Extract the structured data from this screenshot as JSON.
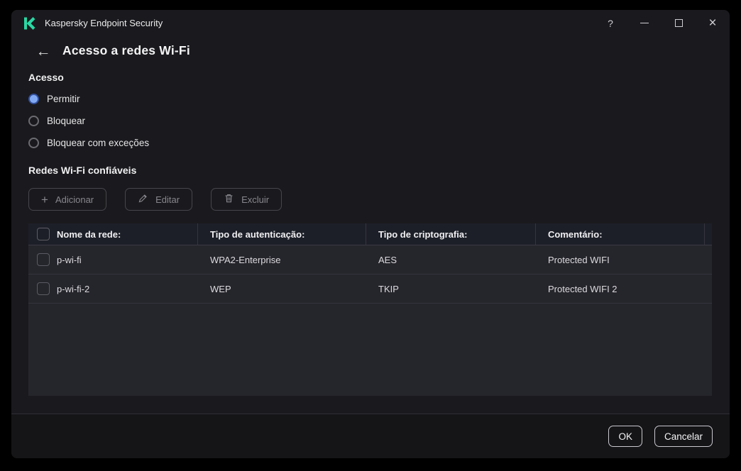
{
  "window": {
    "title": "Kaspersky Endpoint Security",
    "help_glyph": "?"
  },
  "page": {
    "back_glyph": "←",
    "title": "Acesso a redes Wi-Fi"
  },
  "access": {
    "heading": "Acesso",
    "options": [
      {
        "label": "Permitir",
        "selected": true
      },
      {
        "label": "Bloquear",
        "selected": false
      },
      {
        "label": "Bloquear com exceções",
        "selected": false
      }
    ]
  },
  "trusted": {
    "heading": "Redes Wi-Fi confiáveis",
    "toolbar": {
      "add_label": "Adicionar",
      "add_glyph": "+",
      "edit_label": "Editar",
      "delete_label": "Excluir"
    },
    "table": {
      "headers": [
        "Nome da rede:",
        "Tipo de autenticação:",
        "Tipo de criptografia:",
        "Comentário:"
      ],
      "rows": [
        {
          "name": "p-wi-fi",
          "auth": "WPA2-Enterprise",
          "crypto": "AES",
          "comment": "Protected WIFI"
        },
        {
          "name": "p-wi-fi-2",
          "auth": "WEP",
          "crypto": "TKIP",
          "comment": "Protected WIFI 2"
        }
      ]
    }
  },
  "footer": {
    "ok_label": "OK",
    "cancel_label": "Cancelar"
  },
  "colors": {
    "brand_teal": "#2bd7a4",
    "radio_selected_fill": "#82aaf4",
    "radio_selected_ring": "#33509e",
    "table_header_bg": "#1d1f28",
    "table_row_bg": "#25252c",
    "window_bg": "#1a1a1e",
    "footer_bg": "#151518"
  }
}
